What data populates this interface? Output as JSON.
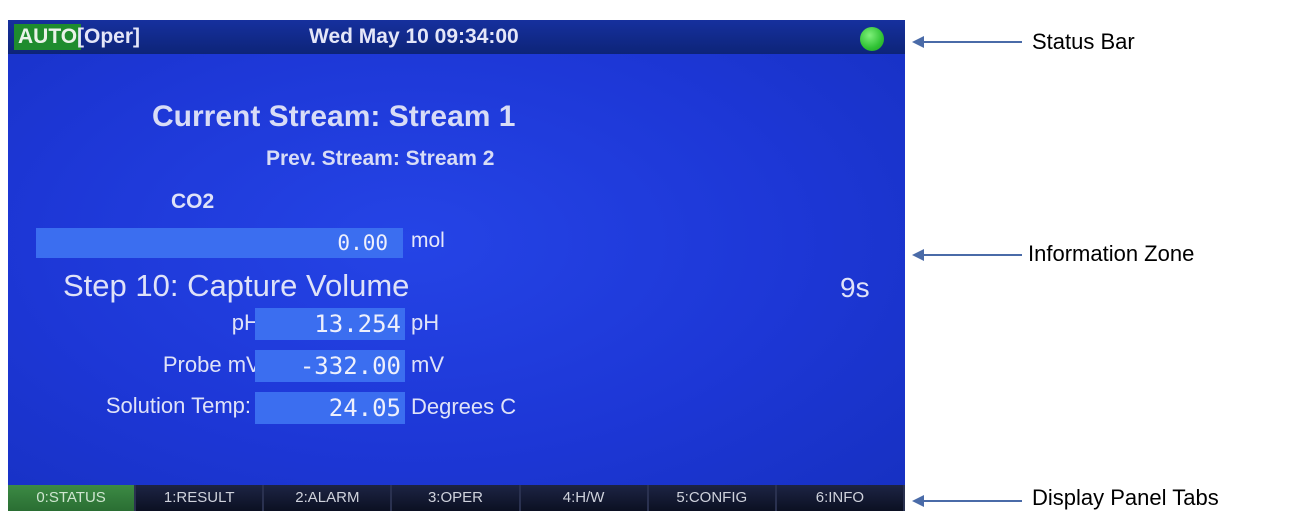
{
  "status_bar": {
    "mode": "AUTO",
    "oper": "[Oper]",
    "datetime": "Wed May 10 09:34:00",
    "led_color": "#2fc234"
  },
  "info": {
    "current_stream": "Current Stream: Stream 1",
    "prev_stream": "Prev. Stream: Stream 2",
    "analyte": "CO2",
    "analyte_value": "0.00",
    "analyte_unit": "mol",
    "step_title": "Step 10: Capture Volume",
    "step_timer": "9s",
    "measurements": [
      {
        "label": "pH:",
        "value": "13.254",
        "unit": "pH"
      },
      {
        "label": "Probe mV:",
        "value": "-332.00",
        "unit": "mV"
      },
      {
        "label": "Solution Temp:",
        "value": "24.05",
        "unit": "Degrees C"
      }
    ]
  },
  "tabs": [
    {
      "label": "0:STATUS",
      "active": true
    },
    {
      "label": "1:RESULT",
      "active": false
    },
    {
      "label": "2:ALARM",
      "active": false
    },
    {
      "label": "3:OPER",
      "active": false
    },
    {
      "label": "4:H/W",
      "active": false
    },
    {
      "label": "5:CONFIG",
      "active": false
    },
    {
      "label": "6:INFO",
      "active": false
    }
  ],
  "annotations": {
    "status_bar": "Status Bar",
    "information_zone": "Information Zone",
    "panel_tabs": "Display Panel Tabs"
  },
  "colors": {
    "screen_blue": "#1f3ad8",
    "value_box": "#3b6ef0",
    "active_tab": "#3c8a44",
    "auto_badge": "#1e8c2e"
  }
}
